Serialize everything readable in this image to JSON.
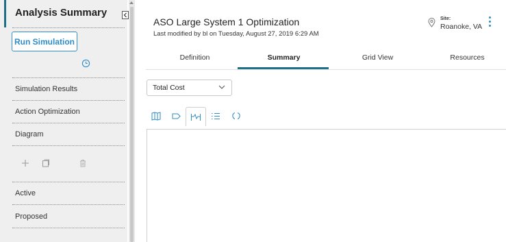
{
  "sidebar": {
    "title": "Analysis Summary",
    "run_button": "Run Simulation",
    "nav_items": [
      "Simulation Results",
      "Action Optimization",
      "Diagram"
    ],
    "status_items": [
      "Active",
      "Proposed"
    ]
  },
  "header": {
    "title": "ASO Large System 1 Optimization",
    "last_modified": "Last modified by bl on Tuesday, August 27, 2019 6:29 AM",
    "site_label": "Site:",
    "site_value": "Roanoke, VA"
  },
  "tabs": [
    {
      "label": "Definition",
      "active": false
    },
    {
      "label": "Summary",
      "active": true
    },
    {
      "label": "Grid View",
      "active": false
    },
    {
      "label": "Resources",
      "active": false
    }
  ],
  "dropdown": {
    "selected": "Total Cost"
  },
  "toolbar": {
    "tools": [
      "map-icon",
      "tag-icon",
      "chart-range-icon",
      "list-icon",
      "refresh-icon"
    ],
    "active_tool": "chart-range-icon"
  },
  "colors": {
    "accent": "#1f6f86",
    "link_blue": "#2e8cc6",
    "sidebar_bg": "#efefef"
  }
}
